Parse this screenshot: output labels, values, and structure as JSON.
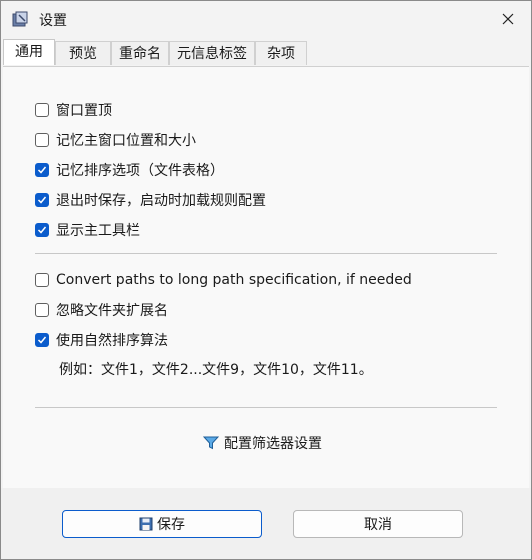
{
  "window": {
    "title": "设置"
  },
  "tabs": [
    {
      "label": "通用",
      "active": true
    },
    {
      "label": "预览"
    },
    {
      "label": "重命名"
    },
    {
      "label": "元信息标签"
    },
    {
      "label": "杂项"
    }
  ],
  "options_group1": [
    {
      "label": "窗口置顶",
      "checked": false
    },
    {
      "label": "记忆主窗口位置和大小",
      "checked": false
    },
    {
      "label": "记忆排序选项（文件表格）",
      "checked": true
    },
    {
      "label": "退出时保存，启动时加载规则配置",
      "checked": true
    },
    {
      "label": "显示主工具栏",
      "checked": true
    }
  ],
  "options_group2": [
    {
      "label": "Convert paths to long path specification, if needed",
      "checked": false
    },
    {
      "label": "忽略文件夹扩展名",
      "checked": false
    },
    {
      "label": "使用自然排序算法",
      "checked": true
    }
  ],
  "natural_sort_example": "例如：文件1，文件2...文件9，文件10，文件11。",
  "filter_link_label": "配置筛选器设置",
  "buttons": {
    "save": "保存",
    "cancel": "取消"
  },
  "colors": {
    "accent": "#0b5ccc"
  }
}
